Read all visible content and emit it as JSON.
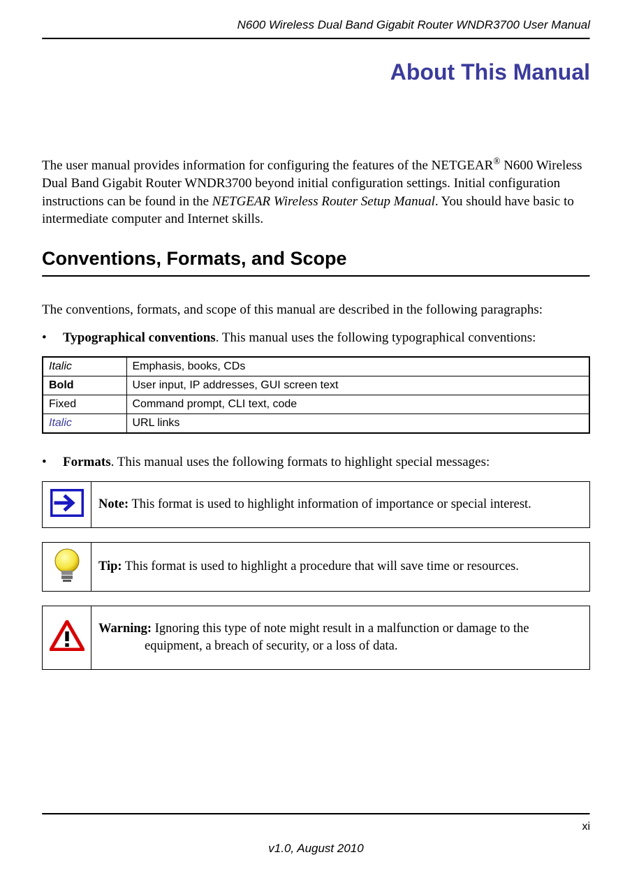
{
  "header": {
    "title": "N600 Wireless Dual Band Gigabit Router WNDR3700 User Manual"
  },
  "chapter": {
    "title": "About This Manual"
  },
  "intro": {
    "p1_part1": "The user manual provides information for configuring the features of the NETGEAR",
    "p1_reg": "®",
    "p1_part2": " N600 Wireless Dual Band Gigabit Router WNDR3700 beyond initial configuration settings. Initial configuration instructions can be found in the ",
    "p1_italic": "NETGEAR Wireless Router Setup Manual",
    "p1_part3": ". You should have basic to intermediate computer and Internet skills."
  },
  "section1": {
    "heading": "Conventions, Formats, and Scope",
    "lead": "The conventions, formats, and scope of this manual are described in the following paragraphs:",
    "bullet1_bold": "Typographical conventions",
    "bullet1_rest": ". This manual uses the following typographical conventions:",
    "bullet2_bold": "Formats",
    "bullet2_rest": ". This manual uses the following formats to highlight special messages:"
  },
  "conv_table": {
    "r1c1": "Italic",
    "r1c2": "Emphasis, books, CDs",
    "r2c1": "Bold",
    "r2c2": "User input, IP addresses, GUI screen text",
    "r3c1": "Fixed",
    "r3c2": "Command prompt, CLI text, code",
    "r4c1": "Italic",
    "r4c2": "URL links"
  },
  "callouts": {
    "note_label": "Note:",
    "note_text": " This format is used to highlight information of importance or special interest.",
    "tip_label": "Tip:",
    "tip_text": " This format is used to highlight a procedure that will save time or resources.",
    "warn_label": "Warning:",
    "warn_text": " Ignoring this type of note might result in a malfunction or damage to the equipment, a breach of security, or a loss of data."
  },
  "footer": {
    "page": "xi",
    "version": "v1.0, August 2010"
  }
}
